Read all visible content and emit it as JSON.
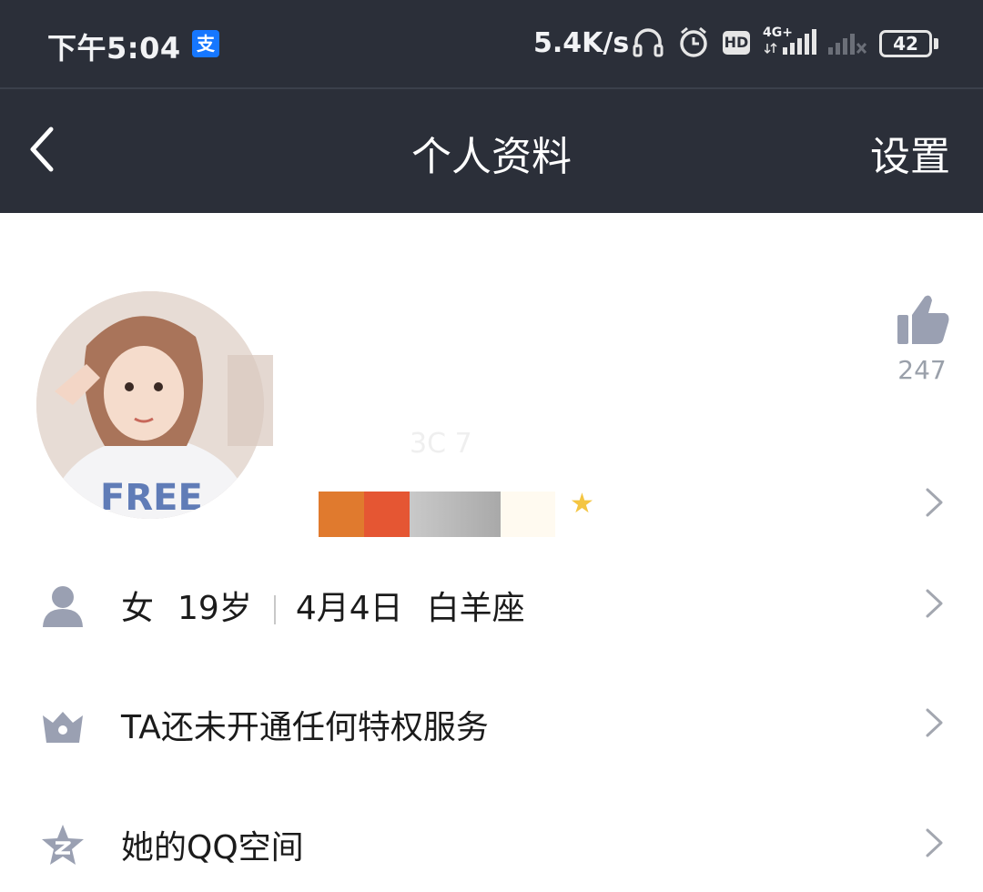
{
  "status_bar": {
    "time": "下午5:04",
    "alipay_glyph": "支",
    "net_speed": "5.4K/s",
    "hd": "HD",
    "network": "4G+",
    "battery": "42",
    "icons": [
      "alipay-icon",
      "headset-icon",
      "alarm-icon",
      "hd-icon",
      "signal-icon",
      "battery-icon"
    ]
  },
  "header": {
    "title": "个人资料",
    "settings_label": "设置"
  },
  "profile": {
    "nickname_partial": "3C      7",
    "likes": "247"
  },
  "rows": [
    {
      "icon": "person-icon",
      "gender": "女",
      "age": "19岁",
      "birthday": "4月4日",
      "zodiac": "白羊座"
    },
    {
      "icon": "crown-icon",
      "text": "TA还未开通任何特权服务"
    },
    {
      "icon": "qzone-star-icon",
      "text": "她的QQ空间"
    }
  ],
  "colors": {
    "bar_bg": "#2b2f39",
    "icon_gray": "#9aa0b2",
    "badge_orange": "#e07a2e",
    "badge_red": "#e55633"
  }
}
